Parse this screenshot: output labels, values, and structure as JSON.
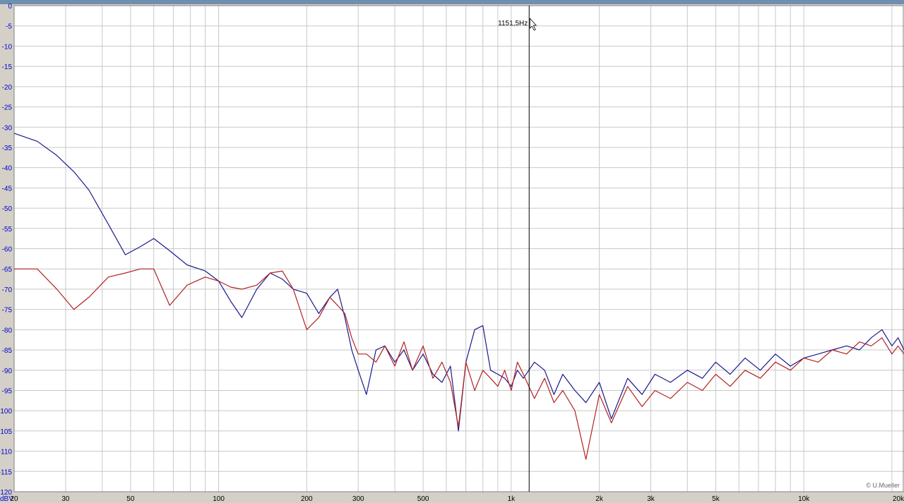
{
  "chart_data": {
    "type": "line",
    "xscale": "log",
    "xlim": [
      20,
      22000
    ],
    "ylim": [
      -120,
      0
    ],
    "grid": true,
    "y_ticks": [
      0,
      -5,
      -10,
      -15,
      -20,
      -25,
      -30,
      -35,
      -40,
      -45,
      -50,
      -55,
      -60,
      -65,
      -70,
      -75,
      -80,
      -85,
      -90,
      -95,
      -100,
      -105,
      -110,
      -115,
      -120
    ],
    "y_tick_labels": [
      "0",
      "-5",
      "-10",
      "-15",
      "-20",
      "-25",
      "-30",
      "-35",
      "-40",
      "-45",
      "-50",
      "-55",
      "-60",
      "-65",
      "-70",
      "-75",
      "-80",
      "-85",
      "-90",
      "-95",
      "-100",
      "-105",
      "-110",
      "-115",
      "120"
    ],
    "y_unit_label": "dBV",
    "x_ticks": [
      20,
      30,
      50,
      100,
      200,
      300,
      500,
      1000,
      2000,
      3000,
      5000,
      10000,
      20000
    ],
    "x_tick_labels": [
      "20",
      "30",
      "50",
      "100",
      "200",
      "300",
      "500",
      "1k",
      "2k",
      "3k",
      "5k",
      "10k",
      "20kHz"
    ],
    "x_grid": [
      20,
      30,
      40,
      50,
      60,
      70,
      80,
      90,
      100,
      200,
      300,
      400,
      500,
      600,
      700,
      800,
      900,
      1000,
      2000,
      3000,
      4000,
      5000,
      6000,
      7000,
      8000,
      9000,
      10000,
      20000
    ],
    "cursor": {
      "freq": 1151.5,
      "label": "1151,5Hz"
    },
    "copyright": "© U.Mueller",
    "series": [
      {
        "color": "#1a1a8c",
        "x": [
          20,
          24,
          28,
          32,
          36,
          42,
          48,
          54,
          60,
          68,
          78,
          90,
          100,
          110,
          120,
          135,
          150,
          165,
          180,
          200,
          220,
          240,
          255,
          270,
          285,
          300,
          320,
          345,
          370,
          400,
          430,
          460,
          500,
          540,
          580,
          620,
          660,
          700,
          750,
          800,
          850,
          900,
          950,
          1000,
          1050,
          1100,
          1200,
          1300,
          1400,
          1500,
          1650,
          1800,
          2000,
          2200,
          2500,
          2800,
          3100,
          3500,
          4000,
          4500,
          5000,
          5600,
          6300,
          7100,
          8000,
          9000,
          10000,
          11200,
          12500,
          14000,
          15500,
          17000,
          18500,
          20000,
          21000,
          22000
        ],
        "y": [
          -31.5,
          -33.5,
          -37,
          -41,
          -45.5,
          -54,
          -61.5,
          -59.5,
          -57.5,
          -60.5,
          -64,
          -65.5,
          -68,
          -73,
          -77,
          -70,
          -66,
          -67.5,
          -70,
          -71,
          -76,
          -72,
          -70,
          -77,
          -85,
          -90,
          -96,
          -85,
          -84,
          -88,
          -85,
          -90,
          -86,
          -91,
          -93,
          -89,
          -105,
          -88,
          -80,
          -79,
          -90,
          -91,
          -92,
          -94,
          -90,
          -92,
          -88,
          -90,
          -96,
          -91,
          -95,
          -98,
          -93,
          -102,
          -92,
          -96,
          -91,
          -93,
          -90,
          -92,
          -88,
          -91,
          -87,
          -90,
          -86,
          -89,
          -87,
          -86,
          -85,
          -84,
          -85,
          -82,
          -80,
          -84,
          -82,
          -85
        ]
      },
      {
        "color": "#b22222",
        "x": [
          20,
          24,
          28,
          32,
          36,
          42,
          48,
          54,
          60,
          68,
          78,
          90,
          100,
          110,
          120,
          135,
          150,
          165,
          180,
          200,
          220,
          240,
          255,
          270,
          285,
          300,
          320,
          345,
          370,
          400,
          430,
          460,
          500,
          540,
          580,
          620,
          660,
          700,
          750,
          800,
          850,
          900,
          950,
          1000,
          1050,
          1100,
          1200,
          1300,
          1400,
          1500,
          1650,
          1800,
          2000,
          2200,
          2500,
          2800,
          3100,
          3500,
          4000,
          4500,
          5000,
          5600,
          6300,
          7100,
          8000,
          9000,
          10000,
          11200,
          12500,
          14000,
          15500,
          17000,
          18500,
          20000,
          21000,
          22000
        ],
        "y": [
          -65,
          -65,
          -70,
          -75,
          -72,
          -67,
          -66,
          -65,
          -65,
          -74,
          -69,
          -67,
          -68,
          -69.5,
          -70,
          -69,
          -66,
          -65.5,
          -70,
          -80,
          -77,
          -72,
          -74,
          -76,
          -82,
          -86,
          -86,
          -88,
          -84,
          -89,
          -83,
          -90,
          -84,
          -92,
          -88,
          -93,
          -104,
          -88,
          -95,
          -90,
          -92,
          -94,
          -90,
          -95,
          -88,
          -91,
          -97,
          -92,
          -98,
          -95,
          -100,
          -112,
          -96,
          -103,
          -94,
          -99,
          -95,
          -97,
          -93,
          -95,
          -91,
          -94,
          -90,
          -92,
          -88,
          -90,
          -87,
          -88,
          -85,
          -86,
          -83,
          -84,
          -82,
          -86,
          -84,
          -86
        ]
      }
    ]
  }
}
